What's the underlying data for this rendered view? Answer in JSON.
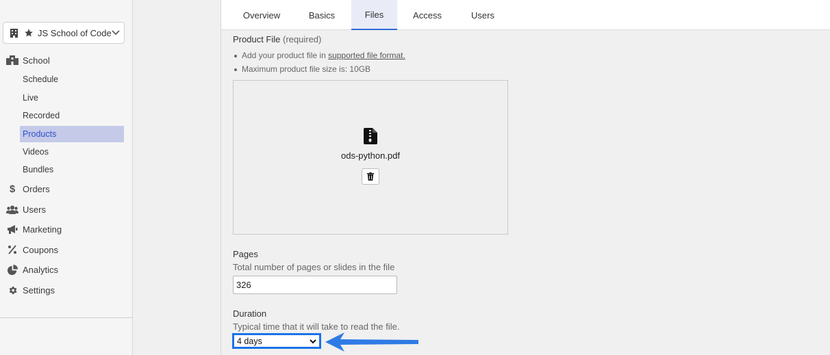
{
  "sidebar": {
    "school_name": "JS School of Code",
    "section": "School",
    "sub_items": [
      {
        "label": "Schedule"
      },
      {
        "label": "Live"
      },
      {
        "label": "Recorded"
      },
      {
        "label": "Products",
        "active": true
      },
      {
        "label": "Videos"
      },
      {
        "label": "Bundles"
      }
    ],
    "top_items": [
      {
        "label": "Orders",
        "icon": "dollar-icon"
      },
      {
        "label": "Users",
        "icon": "users-icon"
      },
      {
        "label": "Marketing",
        "icon": "megaphone-icon"
      },
      {
        "label": "Coupons",
        "icon": "percent-icon"
      },
      {
        "label": "Analytics",
        "icon": "pie-chart-icon"
      },
      {
        "label": "Settings",
        "icon": "gear-icon"
      }
    ]
  },
  "tabs": [
    {
      "label": "Overview"
    },
    {
      "label": "Basics"
    },
    {
      "label": "Files",
      "active": true
    },
    {
      "label": "Access"
    },
    {
      "label": "Users"
    }
  ],
  "product_file": {
    "title": "Product File",
    "required": "(required)",
    "bullet1_prefix": "Add your product file in ",
    "bullet1_link": "supported file format.",
    "bullet2": "Maximum product file size is: 10GB",
    "file_name": "ods-python.pdf"
  },
  "pages": {
    "label": "Pages",
    "help": "Total number of pages or slides in the file",
    "value": "326"
  },
  "duration": {
    "label": "Duration",
    "help": "Typical time that it will take to read the file.",
    "value": "4 days"
  },
  "colors": {
    "accent": "#2f6bd8",
    "active_nav_bg": "#c5cae9",
    "highlight_border": "#1a73e8"
  }
}
